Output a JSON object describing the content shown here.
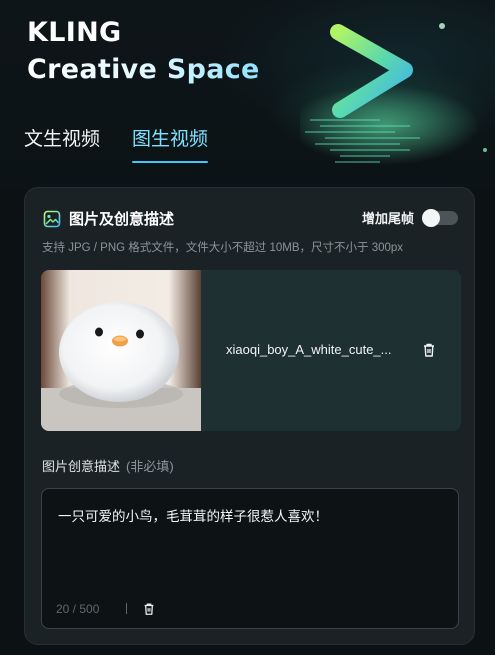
{
  "brand": {
    "line1": "KLING",
    "line2": "Creative Space"
  },
  "tabs": [
    {
      "label": "文生视频",
      "active": false
    },
    {
      "label": "图生视频",
      "active": true
    }
  ],
  "card": {
    "title": "图片及创意描述",
    "title_icon": "image-icon",
    "toggle_label": "增加尾帧",
    "toggle_on": false,
    "hint": "支持 JPG / PNG 格式文件，文件大小不超过 10MB，尺寸不小于 300px",
    "upload": {
      "file_name": "xiaoqi_boy_A_white_cute_...",
      "delete_icon": "trash-icon",
      "thumbnail": "white-fluffy-chick-photo"
    },
    "description": {
      "label": "图片创意描述",
      "optional": "(非必填)",
      "value": "一只可爱的小鸟，毛茸茸的样子很惹人喜欢！",
      "counter": "20 / 500",
      "clear_icon": "trash-icon"
    }
  },
  "colors": {
    "accent": "#43c6ff",
    "card_bg": "#1a2225",
    "page_bg": "#0c1114"
  }
}
